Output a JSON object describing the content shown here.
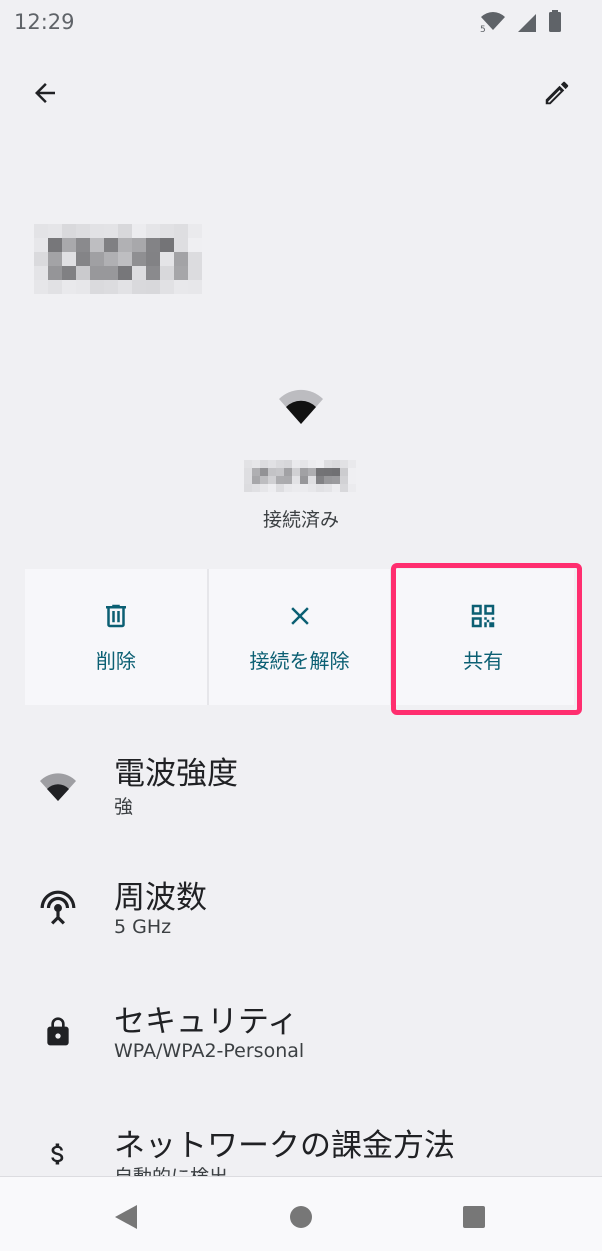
{
  "status_bar": {
    "time": "12:29",
    "icons": [
      "wifi-5-icon",
      "cell-signal-icon",
      "battery-icon"
    ]
  },
  "toolbar": {
    "back_icon": "arrow-left-icon",
    "edit_icon": "pencil-icon"
  },
  "network": {
    "status": "接続済み"
  },
  "actions": [
    {
      "label": "削除",
      "icon": "trash-icon"
    },
    {
      "label": "接続を解除",
      "icon": "close-icon"
    },
    {
      "label": "共有",
      "icon": "qr-code-icon"
    }
  ],
  "details": [
    {
      "title": "電波強度",
      "value": "強",
      "icon": "wifi-signal-icon"
    },
    {
      "title": "周波数",
      "value": "5 GHz",
      "icon": "antenna-icon"
    },
    {
      "title": "セキュリティ",
      "value": "WPA/WPA2-Personal",
      "icon": "lock-icon"
    },
    {
      "title": "ネットワークの課金方法",
      "value": "自動的に検出",
      "icon": "dollar-icon"
    }
  ],
  "colors": {
    "accent": "#0b5f73",
    "highlight": "#ff2e6f",
    "background": "#f0f0f3"
  }
}
